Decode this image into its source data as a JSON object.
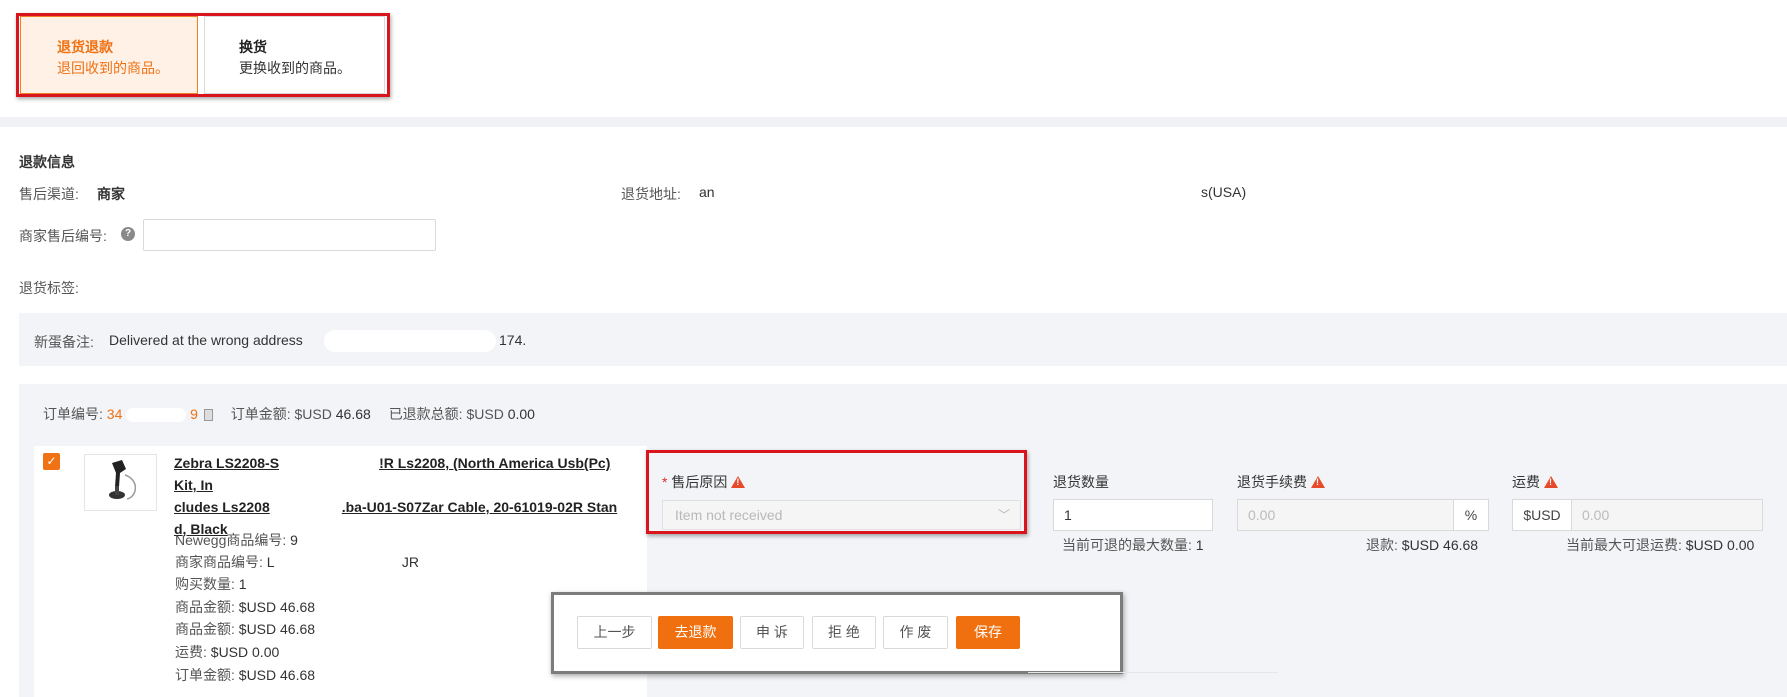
{
  "type_selector": {
    "refund": {
      "title": "退货退款",
      "desc": "退回收到的商品。"
    },
    "exchange": {
      "title": "换货",
      "desc": "更换收到的商品。"
    }
  },
  "refund_info": {
    "section_title": "退款信息",
    "channel_label": "售后渠道:",
    "channel_value": "商家",
    "return_address_label": "退货地址:",
    "return_address_start": "an",
    "return_address_end": "s(USA)",
    "merchant_no_label": "商家售后编号:",
    "merchant_no_value": "",
    "return_tag_label": "退货标签:"
  },
  "note": {
    "label": "新蛋备注:",
    "text_start": "Delivered at the wrong address",
    "text_end": "174."
  },
  "order": {
    "order_no_label": "订单编号:",
    "order_no_start": "34",
    "order_no_end": "9",
    "order_amount_label": "订单金额:",
    "order_amount_currency": "$USD",
    "order_amount_value": "46.68",
    "refunded_total_label": "已退款总额:",
    "refunded_total_currency": "$USD",
    "refunded_total_value": "0.00"
  },
  "product": {
    "checked": true,
    "title_line1_start": "Zebra LS2208-S",
    "title_line1_end": "!R Ls2208, (North America Usb(Pc) Kit, In",
    "title_line2_start": "cludes Ls2208",
    "title_line2_end": ".ba-U01-S07Zar Cable, 20-61019-02R Stan",
    "title_line3": "d, Black",
    "newegg_item_label": "Newegg商品编号:",
    "newegg_item_value": "9",
    "merchant_item_label": "商家商品编号:",
    "merchant_item_start": "L",
    "merchant_item_end": "JR",
    "qty_label": "购买数量:",
    "qty_value": "1",
    "item_amount_label": "商品金额:",
    "item_amount_value": "$USD 46.68",
    "item_amount2_label": "商品金额:",
    "item_amount2_value": "$USD 46.68",
    "shipping_label": "运费:",
    "shipping_value": "$USD 0.00",
    "order_amount_label": "订单金额:",
    "order_amount_value": "$USD 46.68"
  },
  "form": {
    "reason_label": "售后原因",
    "reason_placeholder": "Item not received",
    "return_qty_label": "退货数量",
    "return_qty_value": "1",
    "max_qty_label": "当前可退的最大数量:",
    "max_qty_value": "1",
    "fee_label": "退货手续费",
    "fee_placeholder": "0.00",
    "fee_unit": "%",
    "refund_label": "退款:",
    "refund_currency": "$USD",
    "refund_value": "46.68",
    "shipping_label": "运费",
    "shipping_currency": "$USD",
    "shipping_placeholder": "0.00",
    "max_shipping_label": "当前最大可退运费:",
    "max_shipping_currency": "$USD",
    "max_shipping_value": "0.00"
  },
  "buttons": {
    "prev": "上一步",
    "refund": "去退款",
    "appeal": "申 诉",
    "reject": "拒 绝",
    "void": "作 废",
    "save": "保存"
  },
  "colors": {
    "accent": "#f07010",
    "highlight_frame": "#d9141c"
  }
}
